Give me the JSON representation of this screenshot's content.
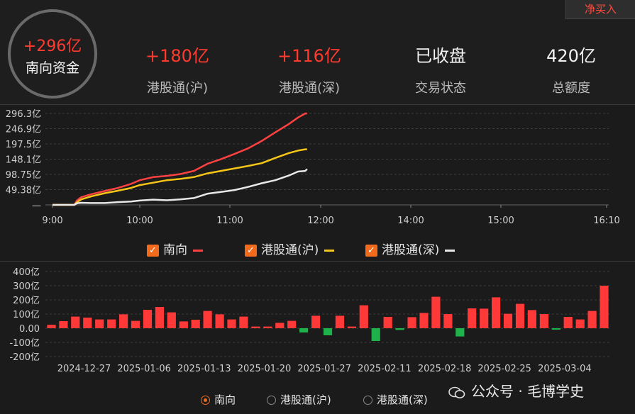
{
  "header": {
    "net_buy_button": "净买入",
    "circle": {
      "value": "+296亿",
      "label": "南向资金"
    },
    "stats": [
      {
        "value": "+180亿",
        "label": "港股通(沪)",
        "color": "red"
      },
      {
        "value": "+116亿",
        "label": "港股通(深)",
        "color": "red"
      },
      {
        "value": "已收盘",
        "label": "交易状态",
        "color": "white"
      },
      {
        "value": "420亿",
        "label": "总额度",
        "color": "white"
      }
    ]
  },
  "intraday_chart": {
    "y_ticks": [
      "296.3亿",
      "246.9亿",
      "197.5亿",
      "148.1亿",
      "98.75亿",
      "49.38亿",
      "—"
    ],
    "x_ticks": [
      "9:00",
      "10:00",
      "11:00",
      "12:00",
      "14:00",
      "15:00",
      "16:10"
    ],
    "legend": [
      {
        "label": "南向",
        "color": "#ff4141"
      },
      {
        "label": "港股通(沪)",
        "color": "#f5c518"
      },
      {
        "label": "港股通(深)",
        "color": "#e8e8e8"
      }
    ]
  },
  "daily_chart": {
    "y_ticks": [
      "400亿",
      "300亿",
      "200亿",
      "100亿",
      "0.00",
      "-100亿",
      "-200亿"
    ],
    "x_ticks": [
      "2024-12-27",
      "2025-01-06",
      "2025-01-13",
      "2025-01-20",
      "2025-01-27",
      "2025-02-11",
      "2025-02-18",
      "2025-02-25",
      "2025-03-04"
    ],
    "legend": [
      {
        "label": "南向",
        "selected": true
      },
      {
        "label": "港股通(沪)",
        "selected": false
      },
      {
        "label": "港股通(深)",
        "selected": false
      }
    ]
  },
  "watermark": "公众号 · 毛博学史",
  "chart_data": [
    {
      "type": "line",
      "x_label_ticks": [
        "9:00",
        "10:00",
        "11:00",
        "12:00",
        "14:00",
        "15:00",
        "16:10"
      ],
      "ylim": [
        0,
        296.3
      ],
      "unit": "亿",
      "series": [
        {
          "name": "南向",
          "color": "#ff4141",
          "points": [
            [
              0,
              0
            ],
            [
              0.1,
              0
            ],
            [
              0.25,
              0
            ],
            [
              0.28,
              14
            ],
            [
              0.33,
              25
            ],
            [
              0.45,
              35
            ],
            [
              0.6,
              45
            ],
            [
              0.75,
              55
            ],
            [
              0.9,
              68
            ],
            [
              1.0,
              80
            ],
            [
              1.15,
              90
            ],
            [
              1.3,
              94
            ],
            [
              1.45,
              100
            ],
            [
              1.6,
              110
            ],
            [
              1.75,
              133
            ],
            [
              1.9,
              148
            ],
            [
              2.05,
              165
            ],
            [
              2.2,
              183
            ],
            [
              2.35,
              207
            ],
            [
              2.5,
              235
            ],
            [
              2.65,
              262
            ],
            [
              2.75,
              283
            ],
            [
              2.83,
              296
            ],
            [
              2.85,
              296
            ]
          ]
        },
        {
          "name": "港股通(沪)",
          "color": "#f5c518",
          "points": [
            [
              0,
              0
            ],
            [
              0.1,
              0
            ],
            [
              0.25,
              0
            ],
            [
              0.28,
              8
            ],
            [
              0.33,
              18
            ],
            [
              0.45,
              28
            ],
            [
              0.6,
              38
            ],
            [
              0.75,
              46
            ],
            [
              0.9,
              55
            ],
            [
              1.0,
              64
            ],
            [
              1.15,
              72
            ],
            [
              1.3,
              80
            ],
            [
              1.45,
              84
            ],
            [
              1.6,
              90
            ],
            [
              1.75,
              102
            ],
            [
              1.9,
              110
            ],
            [
              2.05,
              118
            ],
            [
              2.2,
              126
            ],
            [
              2.35,
              135
            ],
            [
              2.5,
              152
            ],
            [
              2.65,
              168
            ],
            [
              2.75,
              176
            ],
            [
              2.83,
              180
            ],
            [
              2.85,
              180
            ]
          ]
        },
        {
          "name": "港股通(深)",
          "color": "#e8e8e8",
          "points": [
            [
              0,
              0
            ],
            [
              0.1,
              0
            ],
            [
              0.25,
              0
            ],
            [
              0.28,
              5
            ],
            [
              0.33,
              7
            ],
            [
              0.45,
              6
            ],
            [
              0.6,
              6
            ],
            [
              0.75,
              9
            ],
            [
              0.9,
              11
            ],
            [
              1.0,
              14
            ],
            [
              1.15,
              17
            ],
            [
              1.3,
              15
            ],
            [
              1.45,
              18
            ],
            [
              1.6,
              22
            ],
            [
              1.75,
              36
            ],
            [
              1.9,
              42
            ],
            [
              2.05,
              48
            ],
            [
              2.2,
              58
            ],
            [
              2.35,
              70
            ],
            [
              2.5,
              80
            ],
            [
              2.65,
              95
            ],
            [
              2.75,
              108
            ],
            [
              2.83,
              110
            ],
            [
              2.85,
              116
            ]
          ]
        }
      ]
    },
    {
      "type": "bar",
      "unit": "亿",
      "ylim": [
        -200,
        400
      ],
      "x_ticks": [
        "2024-12-27",
        "2025-01-06",
        "2025-01-13",
        "2025-01-20",
        "2025-01-27",
        "2025-02-11",
        "2025-02-18",
        "2025-02-25",
        "2025-03-04"
      ],
      "series": [
        {
          "name": "南向",
          "positive_color": "#ff3838",
          "negative_color": "#1fb24a",
          "values": [
            24,
            50,
            82,
            75,
            62,
            62,
            98,
            52,
            130,
            150,
            112,
            48,
            60,
            122,
            98,
            62,
            82,
            12,
            12,
            38,
            52,
            -30,
            88,
            -50,
            88,
            12,
            162,
            -90,
            80,
            -12,
            78,
            108,
            222,
            100,
            -58,
            140,
            138,
            218,
            102,
            172,
            128,
            100,
            -10,
            80,
            62,
            122,
            300
          ]
        }
      ]
    }
  ]
}
